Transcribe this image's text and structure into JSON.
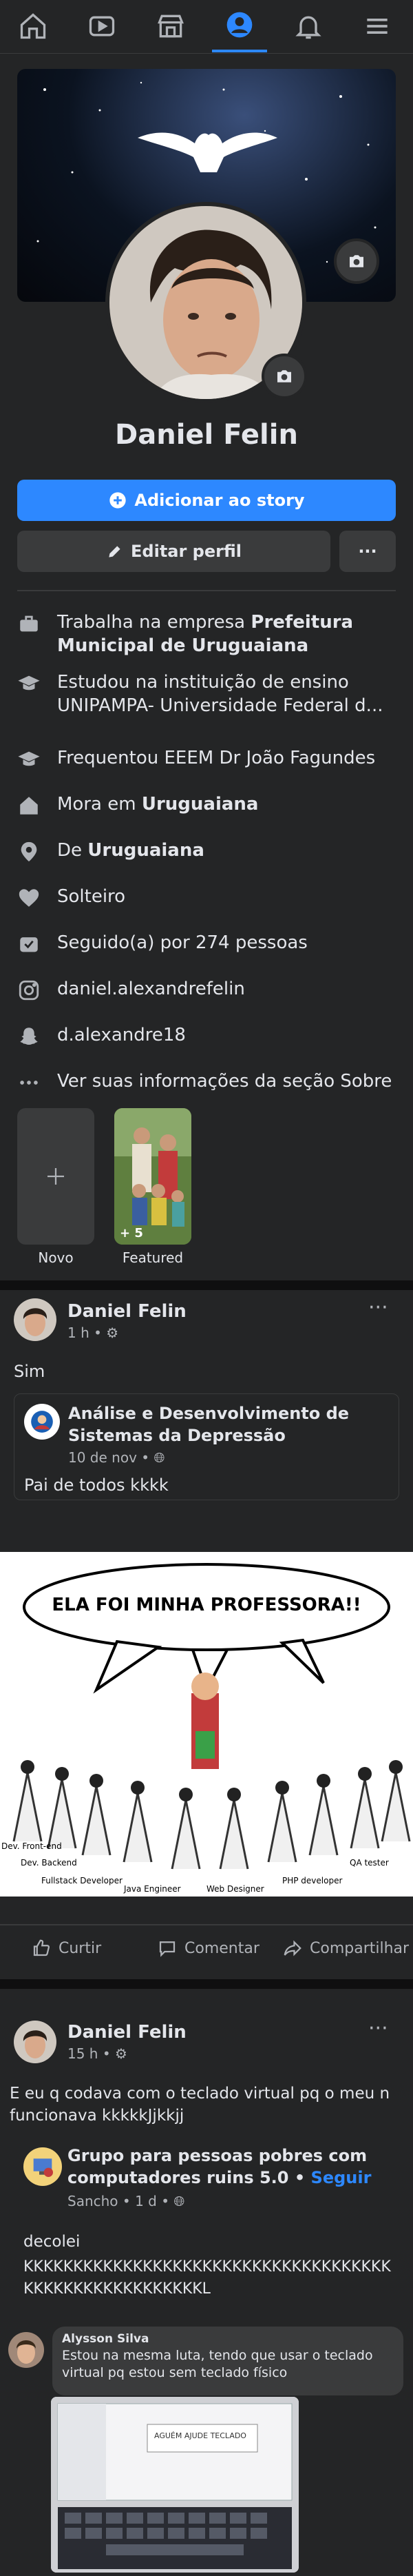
{
  "nav": {
    "items": [
      {
        "name": "home",
        "active": false
      },
      {
        "name": "watch",
        "active": false
      },
      {
        "name": "marketplace",
        "active": false
      },
      {
        "name": "profile",
        "active": true
      },
      {
        "name": "notifications",
        "active": false
      },
      {
        "name": "menu",
        "active": false
      }
    ]
  },
  "profile": {
    "name": "Daniel Felin",
    "add_story_label": "Adicionar ao story",
    "edit_profile_label": "Editar perfil",
    "more_label": "···"
  },
  "intro": {
    "work_prefix": "Trabalha na empresa ",
    "work_company": "Prefeitura Municipal de Uruguaiana",
    "study": "Estudou na instituição de ensino UNIPAMPA- Universidade Federal d...",
    "school_prefix": "Frequentou ",
    "school_name": "EEEM Dr João Fagundes",
    "lives_prefix": "Mora em ",
    "lives_city": "Uruguaiana",
    "from_prefix": "De ",
    "from_city": "Uruguaiana",
    "relationship": "Solteiro",
    "followers": "Seguido(a) por 274 pessoas",
    "instagram": "daniel.alexandrefelin",
    "snapchat": "d.alexandre18",
    "see_about": "Ver suas informações da seção Sobre"
  },
  "featured": {
    "new_label": "Novo",
    "featured_label": "Featured",
    "count": "+ 5"
  },
  "post1": {
    "author": "Daniel Felin",
    "time": "1 h",
    "text": "Sim",
    "shared_group": "Análise e Desenvolvimento de Sistemas da Depressão",
    "shared_time": "10 de nov",
    "shared_text": "Pai de todos kkkk",
    "meme_bubble": "ELA FOI MINHA PROFESSORA!!",
    "meme_labels": [
      "Dev. Front-end",
      "Dev. Backend",
      "Fullstack Developer",
      "Java Engineer",
      "Web Designer",
      "PHP developer",
      "QA tester"
    ],
    "like_label": "Curtir",
    "comment_label": "Comentar",
    "share_label": "Compartilhar"
  },
  "post2": {
    "author": "Daniel Felin",
    "time": "15 h",
    "text": "E eu q codava com o teclado virtual pq o meu n funcionava kkkkkJjkkjj",
    "shared_group": "Grupo para pessoas pobres com computadores ruins 5.0",
    "follow_label": "Seguir",
    "shared_author": "Sancho",
    "shared_time": "1 d",
    "shared_text_1": "decolei",
    "shared_text_2": "KKKKKKKKKKKKKKKKKKKKKKKKKKKKKKKKKKKKKKKKKKKKKKKKKKKKKKKL",
    "comment_author": "Alysson Silva",
    "comment_text": "Estou na mesma luta, tendo que usar o teclado virtual pq estou sem teclado físico",
    "photo_caption": "AGUÉM AJUDE TECLADO"
  },
  "colors": {
    "accent": "#2d88ff",
    "background": "#18191a",
    "surface": "#242526",
    "button": "#3a3b3c"
  }
}
